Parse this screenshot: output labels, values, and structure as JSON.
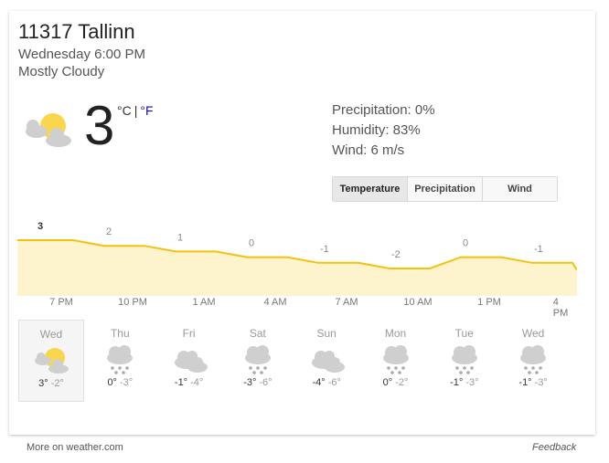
{
  "location": "11317 Tallinn",
  "datetime": "Wednesday 6:00 PM",
  "condition": "Mostly Cloudy",
  "current": {
    "temp": "3",
    "unit_c": "°C",
    "sep": "|",
    "unit_f": "°F",
    "icon": "partly-cloudy-icon"
  },
  "stats": {
    "precipitation": "Precipitation: 0%",
    "humidity": "Humidity: 83%",
    "wind": "Wind: 6 m/s"
  },
  "tabs": [
    "Temperature",
    "Precipitation",
    "Wind"
  ],
  "hourly": {
    "times": [
      "7 PM",
      "10 PM",
      "1 AM",
      "4 AM",
      "7 AM",
      "10 AM",
      "1 PM",
      "4 PM"
    ],
    "labels": [
      "3",
      "2",
      "1",
      "0",
      "-1",
      "-2",
      "0",
      "-1"
    ],
    "temps": [
      3,
      2,
      1,
      0,
      -1,
      -2,
      0,
      -1
    ]
  },
  "daily": [
    {
      "day": "Wed",
      "hi": "3°",
      "lo": "-2°",
      "icon": "partly-cloudy-icon",
      "selected": true
    },
    {
      "day": "Thu",
      "hi": "0°",
      "lo": "-3°",
      "icon": "snow-icon"
    },
    {
      "day": "Fri",
      "hi": "-1°",
      "lo": "-4°",
      "icon": "cloudy-icon"
    },
    {
      "day": "Sat",
      "hi": "-3°",
      "lo": "-6°",
      "icon": "snow-icon"
    },
    {
      "day": "Sun",
      "hi": "-4°",
      "lo": "-6°",
      "icon": "cloudy-icon"
    },
    {
      "day": "Mon",
      "hi": "0°",
      "lo": "-2°",
      "icon": "snow-icon"
    },
    {
      "day": "Tue",
      "hi": "-1°",
      "lo": "-3°",
      "icon": "snow-icon"
    },
    {
      "day": "Wed",
      "hi": "-1°",
      "lo": "-3°",
      "icon": "snow-icon"
    }
  ],
  "footer": {
    "more": "More on weather.com",
    "feedback": "Feedback"
  },
  "colors": {
    "line": "#f4c20d",
    "fill": "#fdf3cd",
    "sun": "#f9d64c",
    "cloud": "#cfcfcf"
  }
}
